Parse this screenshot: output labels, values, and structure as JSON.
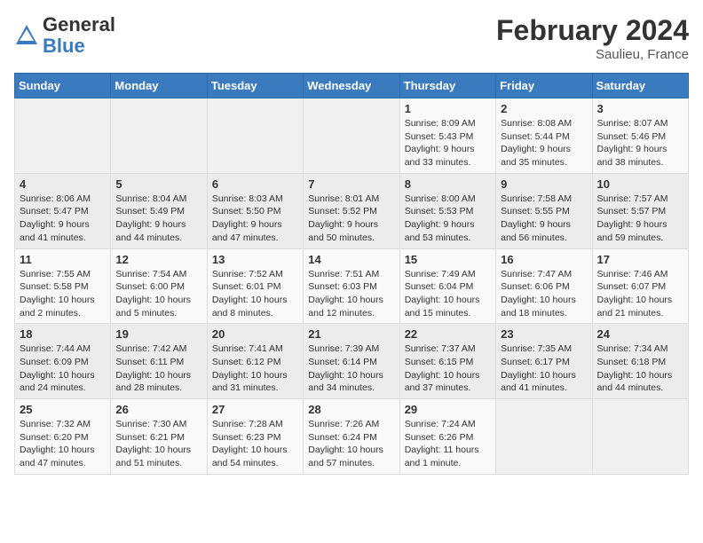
{
  "header": {
    "logo_general": "General",
    "logo_blue": "Blue",
    "month_title": "February 2024",
    "location": "Saulieu, France"
  },
  "days_of_week": [
    "Sunday",
    "Monday",
    "Tuesday",
    "Wednesday",
    "Thursday",
    "Friday",
    "Saturday"
  ],
  "weeks": [
    [
      {
        "day": "",
        "content": ""
      },
      {
        "day": "",
        "content": ""
      },
      {
        "day": "",
        "content": ""
      },
      {
        "day": "",
        "content": ""
      },
      {
        "day": "1",
        "content": "Sunrise: 8:09 AM\nSunset: 5:43 PM\nDaylight: 9 hours\nand 33 minutes."
      },
      {
        "day": "2",
        "content": "Sunrise: 8:08 AM\nSunset: 5:44 PM\nDaylight: 9 hours\nand 35 minutes."
      },
      {
        "day": "3",
        "content": "Sunrise: 8:07 AM\nSunset: 5:46 PM\nDaylight: 9 hours\nand 38 minutes."
      }
    ],
    [
      {
        "day": "4",
        "content": "Sunrise: 8:06 AM\nSunset: 5:47 PM\nDaylight: 9 hours\nand 41 minutes."
      },
      {
        "day": "5",
        "content": "Sunrise: 8:04 AM\nSunset: 5:49 PM\nDaylight: 9 hours\nand 44 minutes."
      },
      {
        "day": "6",
        "content": "Sunrise: 8:03 AM\nSunset: 5:50 PM\nDaylight: 9 hours\nand 47 minutes."
      },
      {
        "day": "7",
        "content": "Sunrise: 8:01 AM\nSunset: 5:52 PM\nDaylight: 9 hours\nand 50 minutes."
      },
      {
        "day": "8",
        "content": "Sunrise: 8:00 AM\nSunset: 5:53 PM\nDaylight: 9 hours\nand 53 minutes."
      },
      {
        "day": "9",
        "content": "Sunrise: 7:58 AM\nSunset: 5:55 PM\nDaylight: 9 hours\nand 56 minutes."
      },
      {
        "day": "10",
        "content": "Sunrise: 7:57 AM\nSunset: 5:57 PM\nDaylight: 9 hours\nand 59 minutes."
      }
    ],
    [
      {
        "day": "11",
        "content": "Sunrise: 7:55 AM\nSunset: 5:58 PM\nDaylight: 10 hours\nand 2 minutes."
      },
      {
        "day": "12",
        "content": "Sunrise: 7:54 AM\nSunset: 6:00 PM\nDaylight: 10 hours\nand 5 minutes."
      },
      {
        "day": "13",
        "content": "Sunrise: 7:52 AM\nSunset: 6:01 PM\nDaylight: 10 hours\nand 8 minutes."
      },
      {
        "day": "14",
        "content": "Sunrise: 7:51 AM\nSunset: 6:03 PM\nDaylight: 10 hours\nand 12 minutes."
      },
      {
        "day": "15",
        "content": "Sunrise: 7:49 AM\nSunset: 6:04 PM\nDaylight: 10 hours\nand 15 minutes."
      },
      {
        "day": "16",
        "content": "Sunrise: 7:47 AM\nSunset: 6:06 PM\nDaylight: 10 hours\nand 18 minutes."
      },
      {
        "day": "17",
        "content": "Sunrise: 7:46 AM\nSunset: 6:07 PM\nDaylight: 10 hours\nand 21 minutes."
      }
    ],
    [
      {
        "day": "18",
        "content": "Sunrise: 7:44 AM\nSunset: 6:09 PM\nDaylight: 10 hours\nand 24 minutes."
      },
      {
        "day": "19",
        "content": "Sunrise: 7:42 AM\nSunset: 6:11 PM\nDaylight: 10 hours\nand 28 minutes."
      },
      {
        "day": "20",
        "content": "Sunrise: 7:41 AM\nSunset: 6:12 PM\nDaylight: 10 hours\nand 31 minutes."
      },
      {
        "day": "21",
        "content": "Sunrise: 7:39 AM\nSunset: 6:14 PM\nDaylight: 10 hours\nand 34 minutes."
      },
      {
        "day": "22",
        "content": "Sunrise: 7:37 AM\nSunset: 6:15 PM\nDaylight: 10 hours\nand 37 minutes."
      },
      {
        "day": "23",
        "content": "Sunrise: 7:35 AM\nSunset: 6:17 PM\nDaylight: 10 hours\nand 41 minutes."
      },
      {
        "day": "24",
        "content": "Sunrise: 7:34 AM\nSunset: 6:18 PM\nDaylight: 10 hours\nand 44 minutes."
      }
    ],
    [
      {
        "day": "25",
        "content": "Sunrise: 7:32 AM\nSunset: 6:20 PM\nDaylight: 10 hours\nand 47 minutes."
      },
      {
        "day": "26",
        "content": "Sunrise: 7:30 AM\nSunset: 6:21 PM\nDaylight: 10 hours\nand 51 minutes."
      },
      {
        "day": "27",
        "content": "Sunrise: 7:28 AM\nSunset: 6:23 PM\nDaylight: 10 hours\nand 54 minutes."
      },
      {
        "day": "28",
        "content": "Sunrise: 7:26 AM\nSunset: 6:24 PM\nDaylight: 10 hours\nand 57 minutes."
      },
      {
        "day": "29",
        "content": "Sunrise: 7:24 AM\nSunset: 6:26 PM\nDaylight: 11 hours\nand 1 minute."
      },
      {
        "day": "",
        "content": ""
      },
      {
        "day": "",
        "content": ""
      }
    ]
  ]
}
